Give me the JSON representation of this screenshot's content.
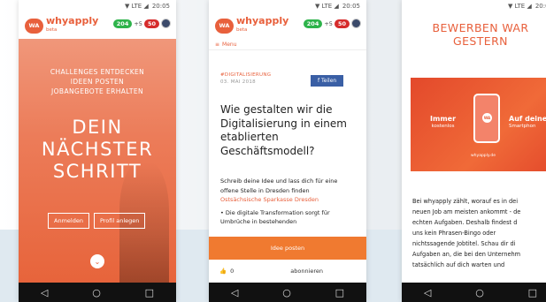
{
  "status": {
    "signal": "▼ LTE ◢",
    "time": "20:05"
  },
  "app": {
    "logo_badge": "WA",
    "logo_name": "whyapply",
    "logo_beta": "beta",
    "points_green": "204",
    "points_plus": "+5",
    "points_red": "50"
  },
  "phone1": {
    "tagline": [
      "CHALLENGES ENTDECKEN",
      "IDEEN POSTEN",
      "JOBANGEBOTE ERHALTEN"
    ],
    "title": [
      "DEIN",
      "NÄCHSTER",
      "SCHRITT"
    ],
    "btn_register": "Anmelden",
    "btn_profile": "Profil anlegen",
    "down_icon": "⌄"
  },
  "phone2": {
    "menu": "Menu",
    "hashtag": "#DIGITALISIERUNG",
    "date": "03. MAI 2018",
    "share": "Teilen",
    "title": "Wie gestalten wir die Digitalisierung in einem etablierten Geschäftsmodell?",
    "body_intro": "Schreib deine Idee und lass dich für eine offene Stelle in Dresden finden",
    "body_link": "Ostsächsische Sparkasse Dresden",
    "bullet": "• Die digitale Transformation sorgt für Umbrüche in bestehenden",
    "cta": "Idee posten",
    "likes": "0",
    "subscribe": "abonnieren"
  },
  "phone3": {
    "title": [
      "BEWERBEN WAR",
      "GESTERN"
    ],
    "video_left": "Immer",
    "video_left_sub": "kostenlos",
    "video_badge": "WA",
    "video_right": "Auf deine",
    "video_right_sub": "Smartphon",
    "video_caption": "whyapply.de",
    "body": [
      "Bei whyapply zählt, worauf es in dei",
      "neuen Job am meisten ankommt - de",
      "echten Aufgaben. Deshalb findest d",
      "uns kein Phrasen-Bingo oder",
      "nichtssagende Jobtitel. Schau dir di",
      "Aufgaben an, die bei den Unternehm",
      "tatsächlich auf dich warten und"
    ]
  },
  "nav": {
    "back": "◁",
    "home": "○",
    "recent": "□"
  }
}
